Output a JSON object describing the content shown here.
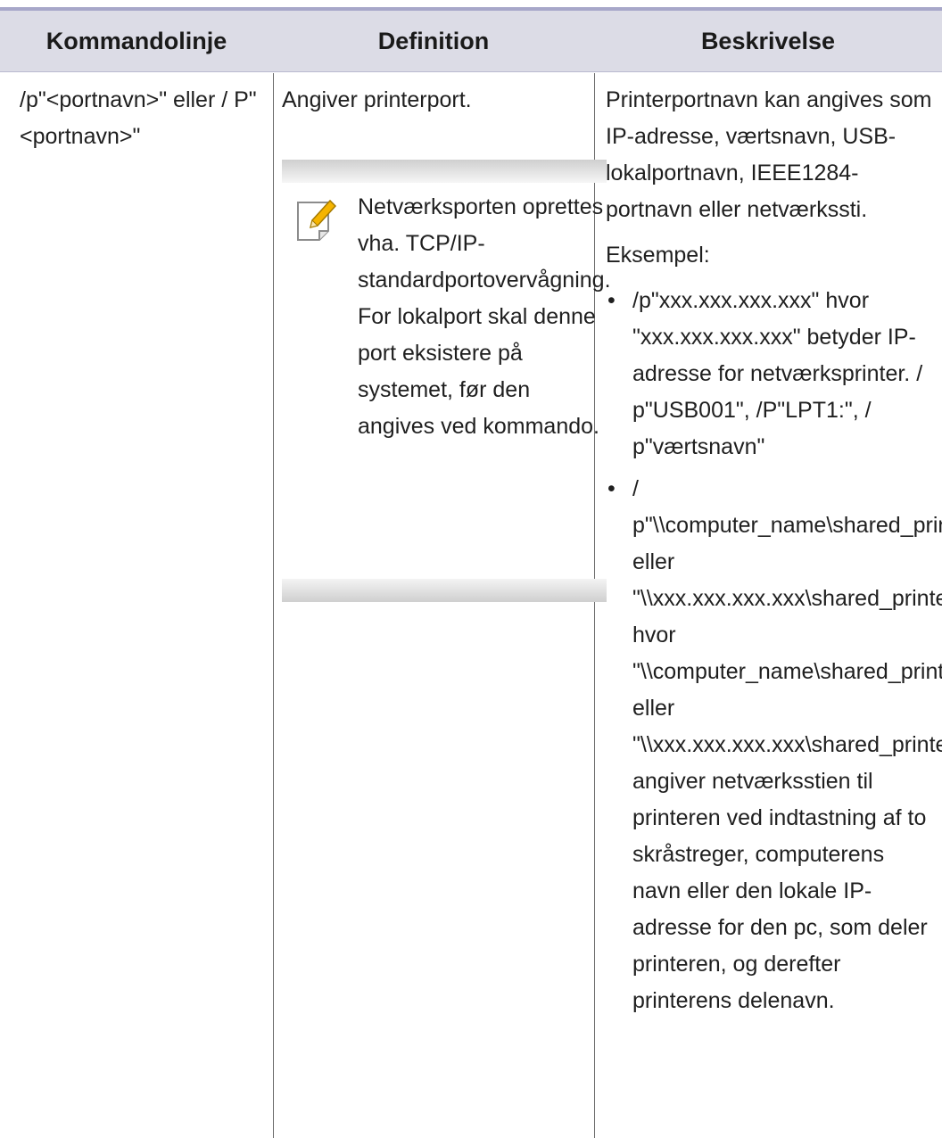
{
  "table": {
    "headers": [
      "Kommandolinje",
      "Definition",
      "Beskrivelse"
    ],
    "row": {
      "command": "/p\"<portnavn>\" eller / P\"<portnavn>\"",
      "definition": "Angiver printerport.",
      "note": "Netværksporten oprettes vha. TCP/IP-standardportovervågning. For lokalport skal denne port eksistere på systemet, før den angives ved kommando.",
      "description": "Printerportnavn kan angives som IP-adresse, værtsnavn, USB-lokalportnavn, IEEE1284-portnavn eller netværkssti.",
      "example_label": "Eksempel:",
      "examples": [
        "/p\"xxx.xxx.xxx.xxx\" hvor \"xxx.xxx.xxx.xxx\" betyder IP-adresse for netværksprinter. / p\"USB001\", /P\"LPT1:\", / p\"værtsnavn\"",
        "/ p\"\\\\computer_name\\shared_printer\" eller \"\\\\xxx.xxx.xxx.xxx\\shared_printer\", hvor \"\\\\computer_name\\shared_printer\" eller \"\\\\xxx.xxx.xxx.xxx\\shared_printer\" angiver netværksstien til printeren ved indtastning af to skråstreger, computerens navn eller den lokale IP-adresse for den pc, som deler printeren, og derefter printerens delenavn."
      ]
    }
  },
  "colors": {
    "header_bg": "#dcdce6",
    "rule": "#a7a7c9",
    "icon_accent": "#f5b400"
  },
  "icons": {
    "note": "note-pencil-icon"
  }
}
